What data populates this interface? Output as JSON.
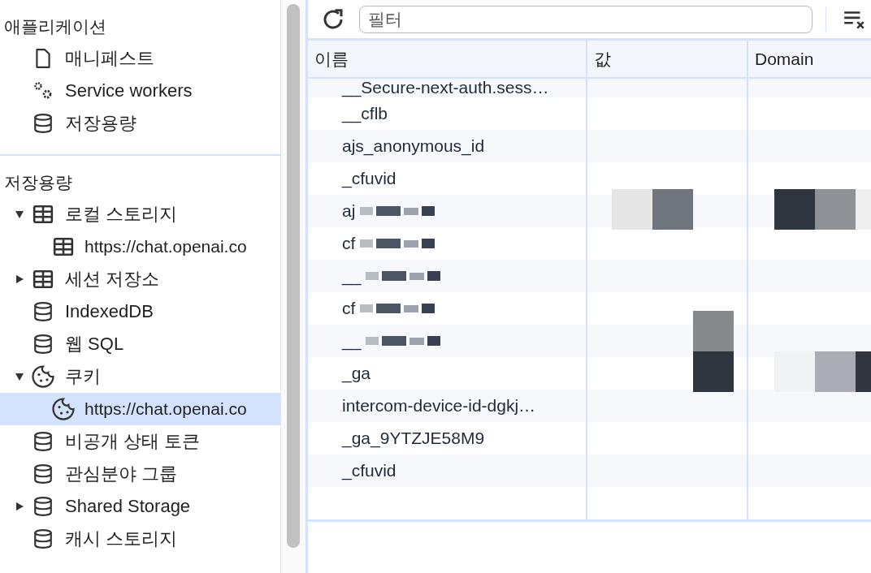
{
  "sidebar": {
    "sections": [
      {
        "title": "애플리케이션",
        "items": [
          {
            "label": "매니페스트",
            "kind": "file",
            "selected": false
          },
          {
            "label": "Service workers",
            "kind": "gears",
            "selected": false
          },
          {
            "label": "저장용량",
            "kind": "database",
            "selected": false
          }
        ]
      },
      {
        "title": "저장용량",
        "items": [
          {
            "label": "로컬 스토리지",
            "kind": "table",
            "selected": false,
            "expanded": true,
            "children": [
              {
                "label": "https://chat.openai.co",
                "kind": "table",
                "selected": false
              }
            ]
          },
          {
            "label": "세션 저장소",
            "kind": "table",
            "selected": false,
            "expanded": false
          },
          {
            "label": "IndexedDB",
            "kind": "database",
            "selected": false
          },
          {
            "label": "웹 SQL",
            "kind": "database",
            "selected": false
          },
          {
            "label": "쿠키",
            "kind": "cookie",
            "selected": false,
            "expanded": true,
            "children": [
              {
                "label": "https://chat.openai.co",
                "kind": "cookie",
                "selected": true
              }
            ]
          },
          {
            "label": "비공개 상태 토큰",
            "kind": "database",
            "selected": false
          },
          {
            "label": "관심분야 그룹",
            "kind": "database",
            "selected": false
          },
          {
            "label": "Shared Storage",
            "kind": "database",
            "selected": false,
            "expanded": false
          },
          {
            "label": "캐시 스토리지",
            "kind": "database",
            "selected": false
          }
        ]
      }
    ]
  },
  "toolbar": {
    "filter": {
      "placeholder": "필터"
    }
  },
  "table": {
    "columns": [
      "이름",
      "값",
      "Domain"
    ],
    "rows": [
      {
        "name": "__Secure-next-auth.sess…",
        "redacted": false
      },
      {
        "name": "__cflb",
        "redacted": false
      },
      {
        "name": "ajs_anonymous_id",
        "redacted": false
      },
      {
        "name": "_cfuvid",
        "redacted": false
      },
      {
        "name": "aj",
        "redacted": true
      },
      {
        "name": "cf",
        "redacted": true
      },
      {
        "name": "__",
        "redacted": true
      },
      {
        "name": "cf",
        "redacted": true
      },
      {
        "name": "__",
        "redacted": true
      },
      {
        "name": "_ga",
        "redacted": false
      },
      {
        "name": "intercom-device-id-dgkj…",
        "redacted": false
      },
      {
        "name": "_ga_9YTZJE58M9",
        "redacted": false
      },
      {
        "name": "_cfuvid",
        "redacted": false
      }
    ]
  }
}
